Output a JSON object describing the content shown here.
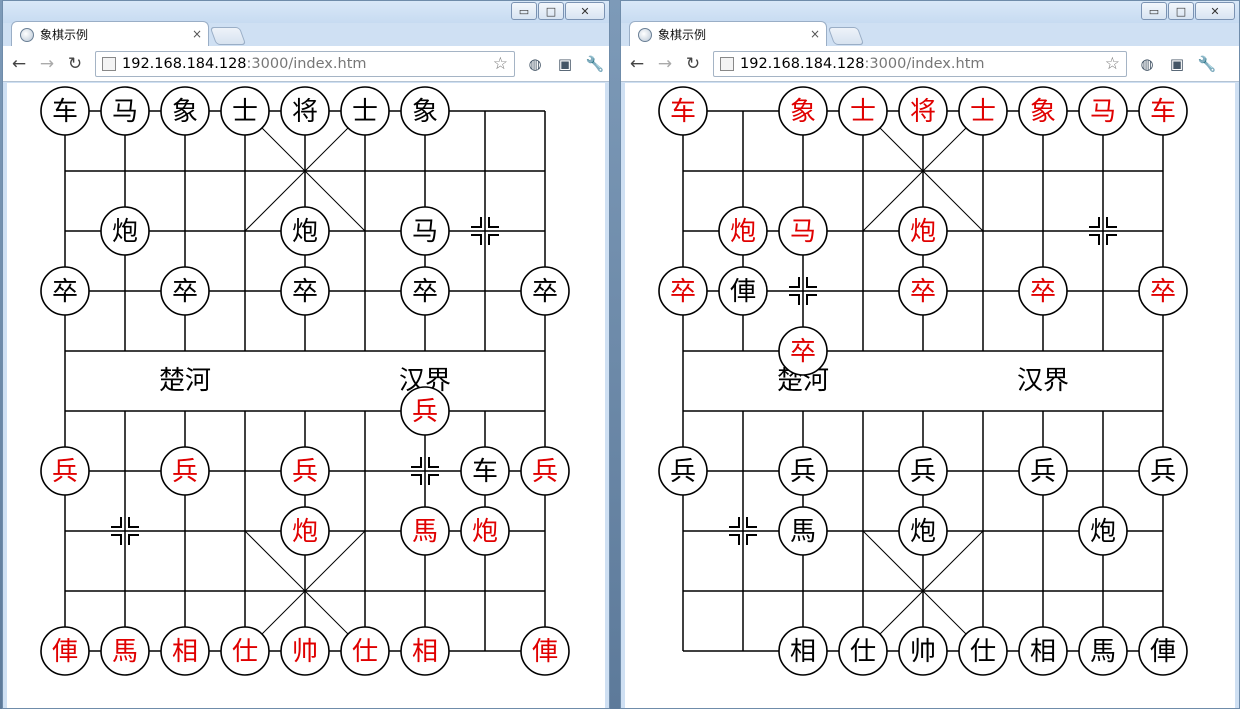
{
  "windows": [
    {
      "id": "left",
      "tab_title": "象棋示例",
      "tab_close": "×",
      "url_host": "192.168.184.128",
      "url_rest": ":3000/index.htm",
      "controls": {
        "minimize": "▭",
        "maximize": "□",
        "close": "✕"
      },
      "board": {
        "river_left": "楚河",
        "river_right": "汉界",
        "pieces": [
          {
            "col": 0,
            "row": 0,
            "text": "车",
            "color": "black"
          },
          {
            "col": 1,
            "row": 0,
            "text": "马",
            "color": "black"
          },
          {
            "col": 2,
            "row": 0,
            "text": "象",
            "color": "black"
          },
          {
            "col": 3,
            "row": 0,
            "text": "士",
            "color": "black"
          },
          {
            "col": 4,
            "row": 0,
            "text": "将",
            "color": "black"
          },
          {
            "col": 5,
            "row": 0,
            "text": "士",
            "color": "black"
          },
          {
            "col": 6,
            "row": 0,
            "text": "象",
            "color": "black"
          },
          {
            "col": 1,
            "row": 2,
            "text": "炮",
            "color": "black"
          },
          {
            "col": 4,
            "row": 2,
            "text": "炮",
            "color": "black"
          },
          {
            "col": 6,
            "row": 2,
            "text": "马",
            "color": "black"
          },
          {
            "col": 0,
            "row": 3,
            "text": "卒",
            "color": "black"
          },
          {
            "col": 2,
            "row": 3,
            "text": "卒",
            "color": "black"
          },
          {
            "col": 4,
            "row": 3,
            "text": "卒",
            "color": "black"
          },
          {
            "col": 6,
            "row": 3,
            "text": "卒",
            "color": "black"
          },
          {
            "col": 8,
            "row": 3,
            "text": "卒",
            "color": "black"
          },
          {
            "col": 6,
            "row": 5,
            "text": "兵",
            "color": "red"
          },
          {
            "col": 0,
            "row": 6,
            "text": "兵",
            "color": "red"
          },
          {
            "col": 2,
            "row": 6,
            "text": "兵",
            "color": "red"
          },
          {
            "col": 4,
            "row": 6,
            "text": "兵",
            "color": "red"
          },
          {
            "col": 7,
            "row": 6,
            "text": "车",
            "color": "black"
          },
          {
            "col": 8,
            "row": 6,
            "text": "兵",
            "color": "red"
          },
          {
            "col": 4,
            "row": 7,
            "text": "炮",
            "color": "red"
          },
          {
            "col": 6,
            "row": 7,
            "text": "馬",
            "color": "red"
          },
          {
            "col": 7,
            "row": 7,
            "text": "炮",
            "color": "red"
          },
          {
            "col": 0,
            "row": 9,
            "text": "俥",
            "color": "red"
          },
          {
            "col": 1,
            "row": 9,
            "text": "馬",
            "color": "red"
          },
          {
            "col": 2,
            "row": 9,
            "text": "相",
            "color": "red"
          },
          {
            "col": 3,
            "row": 9,
            "text": "仕",
            "color": "red"
          },
          {
            "col": 4,
            "row": 9,
            "text": "帅",
            "color": "red"
          },
          {
            "col": 5,
            "row": 9,
            "text": "仕",
            "color": "red"
          },
          {
            "col": 6,
            "row": 9,
            "text": "相",
            "color": "red"
          },
          {
            "col": 8,
            "row": 9,
            "text": "俥",
            "color": "red"
          }
        ],
        "markers": [
          {
            "col": 7,
            "row": 2
          },
          {
            "col": 6,
            "row": 6
          },
          {
            "col": 1,
            "row": 7
          }
        ]
      }
    },
    {
      "id": "right",
      "tab_title": "象棋示例",
      "tab_close": "×",
      "url_host": "192.168.184.128",
      "url_rest": ":3000/index.htm",
      "controls": {
        "minimize": "▭",
        "maximize": "□",
        "close": "✕"
      },
      "board": {
        "river_left": "楚河",
        "river_right": "汉界",
        "pieces": [
          {
            "col": 0,
            "row": 0,
            "text": "车",
            "color": "red"
          },
          {
            "col": 2,
            "row": 0,
            "text": "象",
            "color": "red"
          },
          {
            "col": 3,
            "row": 0,
            "text": "士",
            "color": "red"
          },
          {
            "col": 4,
            "row": 0,
            "text": "将",
            "color": "red"
          },
          {
            "col": 5,
            "row": 0,
            "text": "士",
            "color": "red"
          },
          {
            "col": 6,
            "row": 0,
            "text": "象",
            "color": "red"
          },
          {
            "col": 7,
            "row": 0,
            "text": "马",
            "color": "red"
          },
          {
            "col": 8,
            "row": 0,
            "text": "车",
            "color": "red"
          },
          {
            "col": 1,
            "row": 2,
            "text": "炮",
            "color": "red"
          },
          {
            "col": 2,
            "row": 2,
            "text": "马",
            "color": "red"
          },
          {
            "col": 4,
            "row": 2,
            "text": "炮",
            "color": "red"
          },
          {
            "col": 0,
            "row": 3,
            "text": "卒",
            "color": "red"
          },
          {
            "col": 1,
            "row": 3,
            "text": "俥",
            "color": "black"
          },
          {
            "col": 4,
            "row": 3,
            "text": "卒",
            "color": "red"
          },
          {
            "col": 6,
            "row": 3,
            "text": "卒",
            "color": "red"
          },
          {
            "col": 8,
            "row": 3,
            "text": "卒",
            "color": "red"
          },
          {
            "col": 2,
            "row": 4,
            "text": "卒",
            "color": "red"
          },
          {
            "col": 0,
            "row": 6,
            "text": "兵",
            "color": "black"
          },
          {
            "col": 2,
            "row": 6,
            "text": "兵",
            "color": "black"
          },
          {
            "col": 4,
            "row": 6,
            "text": "兵",
            "color": "black"
          },
          {
            "col": 6,
            "row": 6,
            "text": "兵",
            "color": "black"
          },
          {
            "col": 8,
            "row": 6,
            "text": "兵",
            "color": "black"
          },
          {
            "col": 2,
            "row": 7,
            "text": "馬",
            "color": "black"
          },
          {
            "col": 4,
            "row": 7,
            "text": "炮",
            "color": "black"
          },
          {
            "col": 7,
            "row": 7,
            "text": "炮",
            "color": "black"
          },
          {
            "col": 2,
            "row": 9,
            "text": "相",
            "color": "black"
          },
          {
            "col": 3,
            "row": 9,
            "text": "仕",
            "color": "black"
          },
          {
            "col": 4,
            "row": 9,
            "text": "帅",
            "color": "black"
          },
          {
            "col": 5,
            "row": 9,
            "text": "仕",
            "color": "black"
          },
          {
            "col": 6,
            "row": 9,
            "text": "相",
            "color": "black"
          },
          {
            "col": 7,
            "row": 9,
            "text": "馬",
            "color": "black"
          },
          {
            "col": 8,
            "row": 9,
            "text": "俥",
            "color": "black"
          }
        ],
        "markers": [
          {
            "col": 7,
            "row": 2
          },
          {
            "col": 2,
            "row": 3
          },
          {
            "col": 1,
            "row": 7
          }
        ]
      }
    }
  ],
  "colors": {
    "red": "#e00000",
    "black": "#000000"
  }
}
